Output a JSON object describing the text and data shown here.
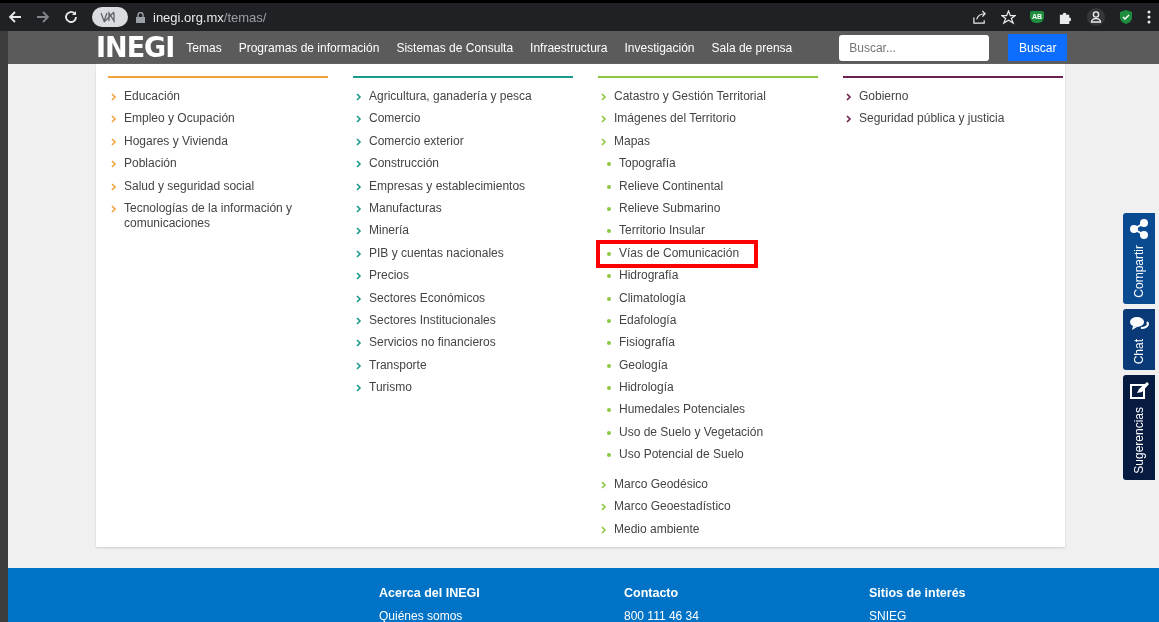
{
  "browser": {
    "url_host": "inegi.org.mx",
    "url_path": "/temas/",
    "extension_label": "AB"
  },
  "nav": {
    "logo": "INEGI",
    "items": [
      "Temas",
      "Programas de información",
      "Sistemas de Consulta",
      "Infraestructura",
      "Investigación",
      "Sala de prensa"
    ],
    "search": {
      "placeholder": "Buscar..."
    },
    "search_button": "Buscar"
  },
  "columns": [
    {
      "color": "#f0a33c",
      "items": [
        {
          "label": "Educación"
        },
        {
          "label": "Empleo y Ocupación"
        },
        {
          "label": "Hogares y Vivienda"
        },
        {
          "label": "Población"
        },
        {
          "label": "Salud y seguridad social"
        },
        {
          "label": "Tecnologías de la información y comunicaciones"
        }
      ]
    },
    {
      "color": "#1a9b8c",
      "items": [
        {
          "label": "Agricultura, ganadería y pesca"
        },
        {
          "label": "Comercio"
        },
        {
          "label": "Comercio exterior"
        },
        {
          "label": "Construcción"
        },
        {
          "label": "Empresas y establecimientos"
        },
        {
          "label": "Manufacturas"
        },
        {
          "label": "Minería"
        },
        {
          "label": "PIB y cuentas nacionales"
        },
        {
          "label": "Precios"
        },
        {
          "label": "Sectores Económicos"
        },
        {
          "label": "Sectores Institucionales"
        },
        {
          "label": "Servicios no financieros"
        },
        {
          "label": "Transporte"
        },
        {
          "label": "Turismo"
        }
      ]
    },
    {
      "color": "#8dc63f",
      "items": [
        {
          "label": "Catastro y Gestión Territorial"
        },
        {
          "label": "Imágenes del Territorio"
        },
        {
          "label": "Mapas",
          "children": [
            {
              "label": "Topografía",
              "highlighted": false
            },
            {
              "label": "Relieve Continental",
              "highlighted": false
            },
            {
              "label": "Relieve Submarino",
              "highlighted": false
            },
            {
              "label": "Territorio Insular",
              "highlighted": false
            },
            {
              "label": "Vías de Comunicación",
              "highlighted": true
            },
            {
              "label": "Hidrografía",
              "highlighted": false
            },
            {
              "label": "Climatología",
              "highlighted": false
            },
            {
              "label": "Edafología",
              "highlighted": false
            },
            {
              "label": "Fisiografía",
              "highlighted": false
            },
            {
              "label": "Geología",
              "highlighted": false
            },
            {
              "label": "Hidrología",
              "highlighted": false
            },
            {
              "label": "Humedales Potenciales",
              "highlighted": false
            },
            {
              "label": "Uso de Suelo y Vegetación",
              "highlighted": false
            },
            {
              "label": "Uso Potencial de Suelo",
              "highlighted": false
            }
          ]
        },
        {
          "label": "Marco Geodésico"
        },
        {
          "label": "Marco Geoestadístico"
        },
        {
          "label": "Medio ambiente"
        }
      ]
    },
    {
      "color": "#6d2150",
      "items": [
        {
          "label": "Gobierno"
        },
        {
          "label": "Seguridad pública y justicia"
        }
      ]
    }
  ],
  "side_tabs": [
    {
      "label": "Compartir",
      "kind": "share"
    },
    {
      "label": "Chat",
      "kind": "chat"
    },
    {
      "label": "Sugerencias",
      "kind": "edit"
    }
  ],
  "footer": [
    {
      "heading": "Acerca del INEGI",
      "item": "Quiénes somos"
    },
    {
      "heading": "Contacto",
      "item": "800 111 46 34"
    },
    {
      "heading": "Sitios de interés",
      "item": "SNIEG"
    }
  ]
}
